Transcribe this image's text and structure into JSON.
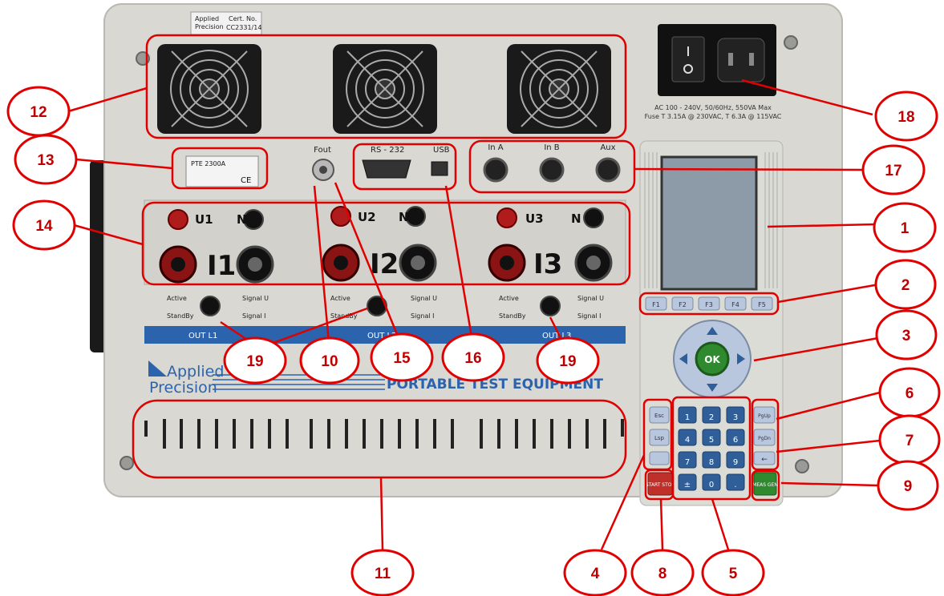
{
  "device": {
    "cert_brand_line1": "Applied",
    "cert_brand_line2": "Precision",
    "cert_title": "Cert. No.",
    "cert_number": "CC2331/14",
    "power_spec_line1": "AC 100 - 240V, 50/60Hz, 550VA Max",
    "power_spec_line2": "Fuse T 3.15A @ 230VAC, T 6.3A @ 115VAC",
    "model_label": "PTE 2300A",
    "fout_label": "Fout",
    "rs232_label": "RS - 232",
    "usb_label": "USB",
    "input_labels": [
      "In A",
      "In B",
      "Aux"
    ],
    "channels": [
      {
        "u": "U1",
        "n": "N",
        "i": "I1",
        "out": "OUT L1"
      },
      {
        "u": "U2",
        "n": "N",
        "i": "I2",
        "out": "OUT L2"
      },
      {
        "u": "U3",
        "n": "N",
        "i": "I3",
        "out": "OUT L3"
      }
    ],
    "status_labels": {
      "active": "Active",
      "standby": "StandBy",
      "signal_u": "Signal U",
      "signal_i": "Signal I"
    },
    "fkeys": [
      "F1",
      "F2",
      "F3",
      "F4",
      "F5"
    ],
    "ok_label": "OK",
    "brand_line1": "Applied",
    "brand_line2": "Precision",
    "product_line": "PORTABLE TEST EQUIPMENT",
    "left_keys": [
      "Esc",
      "Lsp"
    ],
    "numpad": [
      "1",
      "2",
      "3",
      "4",
      "5",
      "6",
      "7",
      "8",
      "9",
      "±",
      "0",
      "."
    ],
    "right_keys": [
      "PgUp",
      "PgDn",
      "←"
    ],
    "start_stop": "START STOP",
    "meas_gen": "MEAS GEN"
  },
  "callouts": [
    "1",
    "2",
    "3",
    "4",
    "5",
    "6",
    "7",
    "8",
    "9",
    "10",
    "11",
    "12",
    "13",
    "14",
    "15",
    "16",
    "17",
    "18",
    "19",
    "19"
  ],
  "colors": {
    "annotation": "#e00000",
    "panel": "#d9d8d2",
    "screen": "#8d9aa8",
    "key_blue": "#2f5e99",
    "strip_blue": "#2b63ad"
  }
}
